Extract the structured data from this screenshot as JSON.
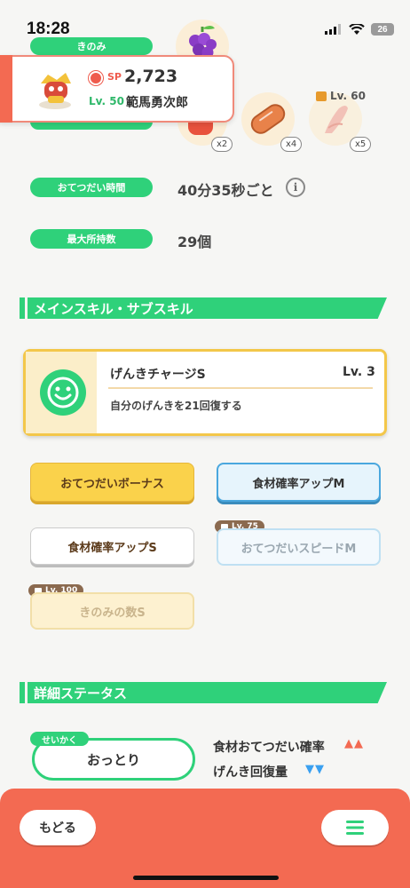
{
  "status": {
    "time": "18:28",
    "battery": "26"
  },
  "berry": {
    "label": "きのみ"
  },
  "pokemon": {
    "sp_label": "SP",
    "sp_value": "2,723",
    "level": "Lv. 50",
    "name": "範馬勇次郎"
  },
  "ingredients": [
    {
      "qty": "x2",
      "color": "#e8523d"
    },
    {
      "qty": "x4",
      "color": "#e8824a"
    },
    {
      "qty": "x5",
      "color": "#f1b0a3",
      "lock_level": "Lv. 60"
    }
  ],
  "help_time": {
    "label": "おてつだい時間",
    "value": "40分35秒ごと"
  },
  "max_carry": {
    "label": "最大所持数",
    "value": "29個"
  },
  "skills_section": {
    "title": "メインスキル・サブスキル"
  },
  "main_skill": {
    "name": "げんきチャージS",
    "level": "Lv. 3",
    "description": "自分のげんきを21回復する"
  },
  "sub_skills": [
    {
      "label": "おてつだいボーナス"
    },
    {
      "label": "食材確率アップM"
    },
    {
      "label": "食材確率アップS"
    },
    {
      "label": "おてつだいスピードM",
      "lock_level": "Lv. 75"
    },
    {
      "label": "きのみの数S",
      "lock_level": "Lv. 100"
    }
  ],
  "details_section": {
    "title": "詳細ステータス"
  },
  "nature": {
    "tag": "せいかく",
    "value": "おっとり"
  },
  "stats": [
    {
      "label": "食材おてつだい確率",
      "arrows": "▲▲",
      "color": "#f36a52"
    },
    {
      "label": "げんき回復量",
      "arrows": "▼▼",
      "color": "#3aa0f0"
    }
  ],
  "bottom": {
    "back_label": "もどる"
  },
  "colors": {
    "accent": "#2fd17a",
    "bottom_bar": "#f36a52",
    "gold": "#f3c74a"
  }
}
